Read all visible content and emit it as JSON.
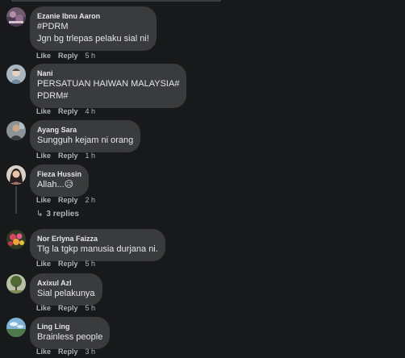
{
  "comments": [
    {
      "name": "Ezanie Ibnu Aaron",
      "lines": [
        "#PDRM",
        "Jgn bg trlepas pelaku sial ni!"
      ],
      "like": "Like",
      "reply": "Reply",
      "time": "5 h",
      "avatar_icon": "profile-photo-landscape-icon"
    },
    {
      "name": "Nani",
      "lines": [
        "PERSATUAN HAIWAN MALAYSIA#",
        "PDRM#"
      ],
      "like": "Like",
      "reply": "Reply",
      "time": "4 h",
      "avatar_icon": "profile-photo-child-icon"
    },
    {
      "name": "Ayang Sara",
      "lines": [
        "Sungguh kejam ni orang"
      ],
      "like": "Like",
      "reply": "Reply",
      "time": "1 h",
      "avatar_icon": "profile-photo-person-icon"
    },
    {
      "name": "Fieza Hussin",
      "lines": [
        "Allah...😥"
      ],
      "like": "Like",
      "reply": "Reply",
      "time": "2 h",
      "avatar_icon": "profile-photo-woman-icon"
    },
    {
      "name": "Nor Erlyna Faizza",
      "lines": [
        "Tlg la tgkp manusia durjana ni."
      ],
      "like": "Like",
      "reply": "Reply",
      "time": "5 h",
      "avatar_icon": "profile-photo-flowers-icon"
    },
    {
      "name": "Axixul Azl",
      "lines": [
        "Sial pelakunya"
      ],
      "like": "Like",
      "reply": "Reply",
      "time": "5 h",
      "avatar_icon": "profile-photo-tree-icon"
    },
    {
      "name": "Ling Ling",
      "lines": [
        "Brainless people"
      ],
      "like": "Like",
      "reply": "Reply",
      "time": "3 h",
      "avatar_icon": "profile-photo-sky-icon"
    }
  ],
  "replies_link": {
    "arrow": "↳",
    "label": "3 replies"
  },
  "colors": {
    "background": "#18191a",
    "bubble": "#3a3b3c",
    "text": "#e4e6eb",
    "secondary_text": "#b0b3b8"
  }
}
